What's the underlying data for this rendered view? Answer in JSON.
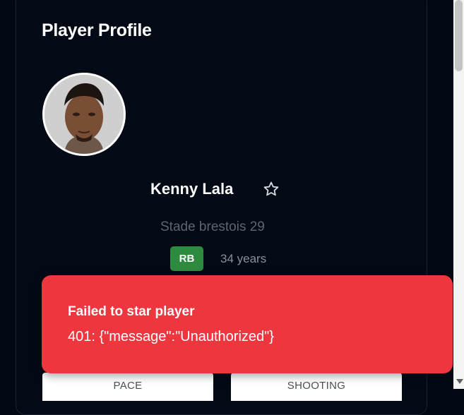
{
  "page": {
    "title": "Player Profile"
  },
  "player": {
    "name": "Kenny Lala",
    "club": "Stade brestois 29",
    "position": "RB",
    "age": "34 years"
  },
  "stats": {
    "pace_label": "PACE",
    "shooting_label": "SHOOTING"
  },
  "toast": {
    "title": "Failed to star player",
    "message": "401: {\"message\":\"Unauthorized\"}",
    "color": "#ee363f"
  },
  "colors": {
    "background": "#020814",
    "position_badge": "#2e8a3e"
  },
  "icons": {
    "favorite": "star-outline-icon",
    "avatar": "player-photo"
  }
}
